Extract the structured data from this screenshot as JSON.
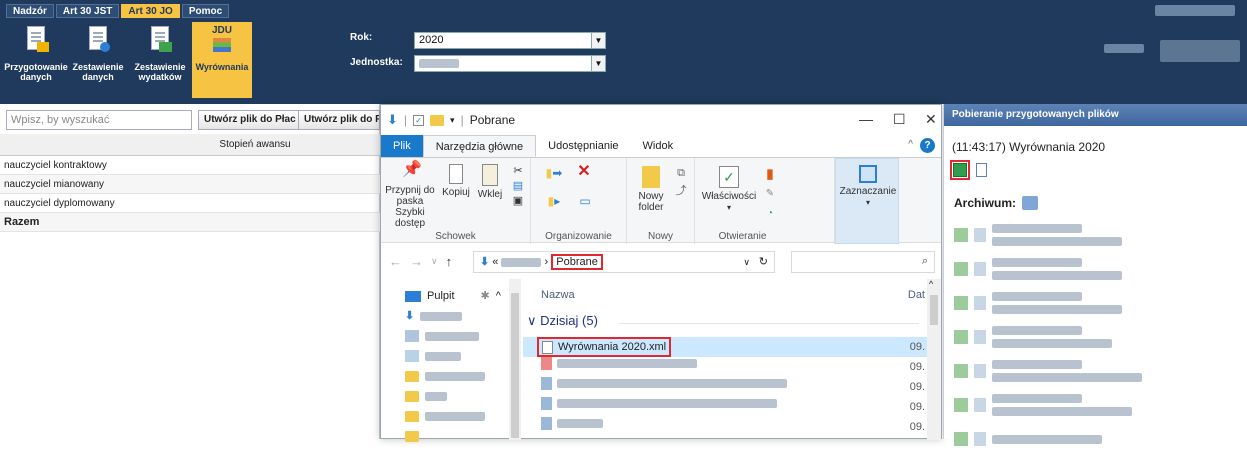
{
  "menu": [
    "Nadzór",
    "Art 30 JST",
    "Art 30 JO",
    "Pomoc"
  ],
  "menu_active_index": 2,
  "ribbon": [
    {
      "label": "Przygotowanie danych",
      "icon": "doc-edit-icon"
    },
    {
      "label": "Zestawienie danych",
      "icon": "doc-info-icon"
    },
    {
      "label": "Zestawienie wydatków",
      "icon": "doc-green-icon"
    },
    {
      "label": "Wyrównania",
      "icon": "jdu-books-icon",
      "badge": "JDU"
    }
  ],
  "filters": {
    "rok_label": "Rok:",
    "rok_value": "2020",
    "jednostka_label": "Jednostka:"
  },
  "left": {
    "search_placeholder": "Wpisz, by wyszukać",
    "btn_plac": "Utwórz plik do Płac",
    "btn_f": "Utwórz plik do F",
    "col_header": "Stopień awansu",
    "rows": [
      "nauczyciel kontraktowy",
      "nauczyciel mianowany",
      "nauczyciel dyplomowany",
      "Razem"
    ]
  },
  "explorer": {
    "title": "Pobrane",
    "tabs": [
      "Plik",
      "Narzędzia główne",
      "Udostępnianie",
      "Widok"
    ],
    "ribbon": {
      "pin": "Przypnij do paska Szybki dostęp",
      "copy": "Kopiuj",
      "paste": "Wklej",
      "group_clipboard": "Schowek",
      "group_organize": "Organizowanie",
      "new_folder": "Nowy folder",
      "group_new": "Nowy",
      "properties": "Właściwości",
      "group_open": "Otwieranie",
      "select": "Zaznaczanie"
    },
    "address_sep": "«",
    "address_current": "Pobrane",
    "nav": {
      "desktop": "Pulpit"
    },
    "col_name": "Nazwa",
    "col_date": "Dat",
    "group": "Dzisiaj (5)",
    "files": [
      {
        "name": "Wyrównania 2020.xml",
        "date": "09.",
        "selected": true
      },
      {
        "name": "",
        "date": "09."
      },
      {
        "name": "",
        "date": "09."
      },
      {
        "name": "",
        "date": "09."
      },
      {
        "name": "",
        "date": "09."
      }
    ]
  },
  "right": {
    "header": "Pobieranie przygotowanych plików",
    "entry": "(11:43:17) Wyrównania 2020",
    "archive_label": "Archiwum:"
  },
  "colors": {
    "accent": "#f6c342",
    "header_bg": "#1f3a5c",
    "highlight": "#e0282e",
    "selection": "#cce8ff"
  }
}
